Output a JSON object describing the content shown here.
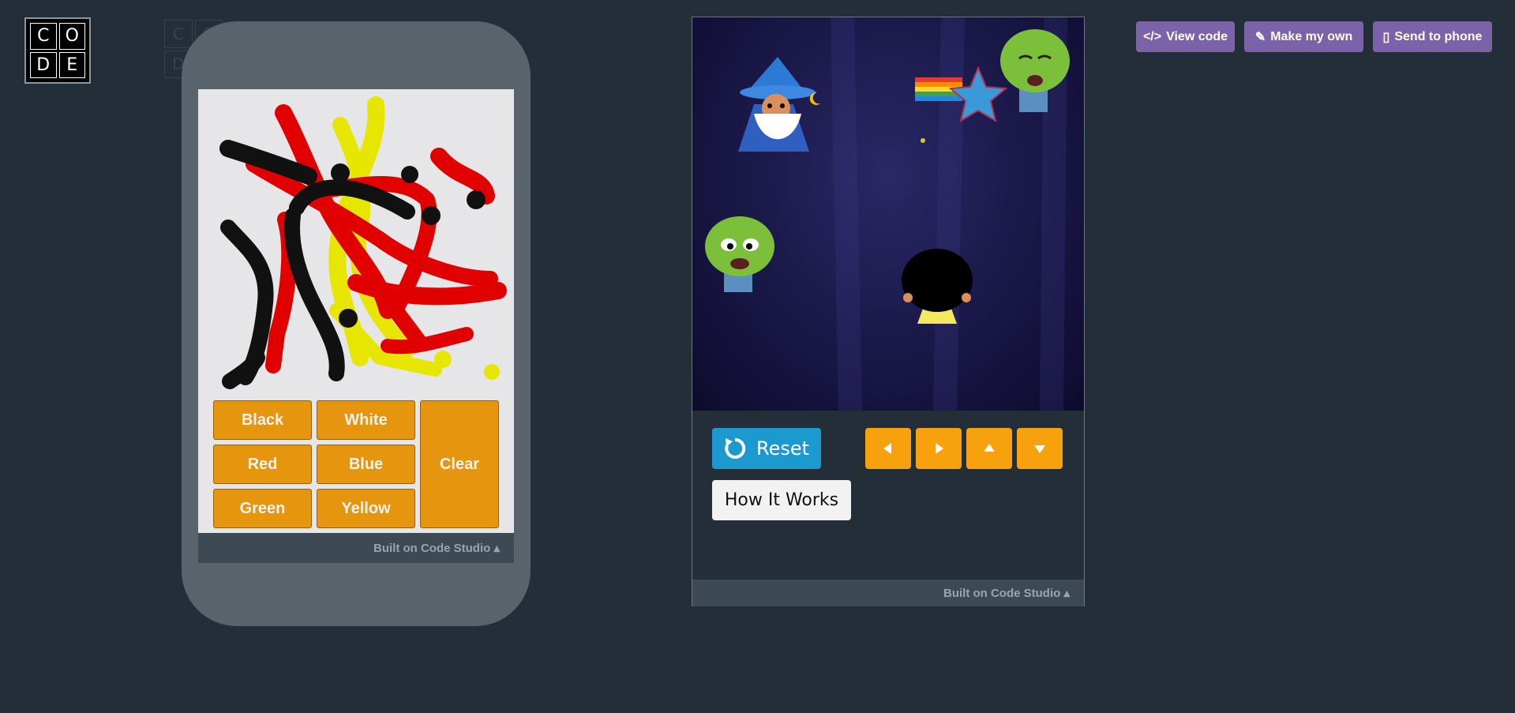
{
  "logo": {
    "letters": [
      "C",
      "O",
      "D",
      "E"
    ]
  },
  "phone_app": {
    "buttons": {
      "black": "Black",
      "white": "White",
      "red": "Red",
      "blue": "Blue",
      "green": "Green",
      "yellow": "Yellow",
      "clear": "Clear"
    },
    "footer": "Built on Code Studio ▴"
  },
  "game": {
    "reset_label": "Reset",
    "how_it_works_label": "How It Works",
    "footer": "Built on Code Studio ▴",
    "arrows": [
      "left",
      "right",
      "up",
      "down"
    ]
  },
  "header_buttons": {
    "view_code": "View code",
    "make_my_own": "Make my own",
    "send_to_phone": "Send to phone"
  },
  "colors": {
    "accent_orange": "#e5950e",
    "reset_blue": "#1c9ad0",
    "header_purple": "#7c62a8",
    "background": "#232e38"
  }
}
